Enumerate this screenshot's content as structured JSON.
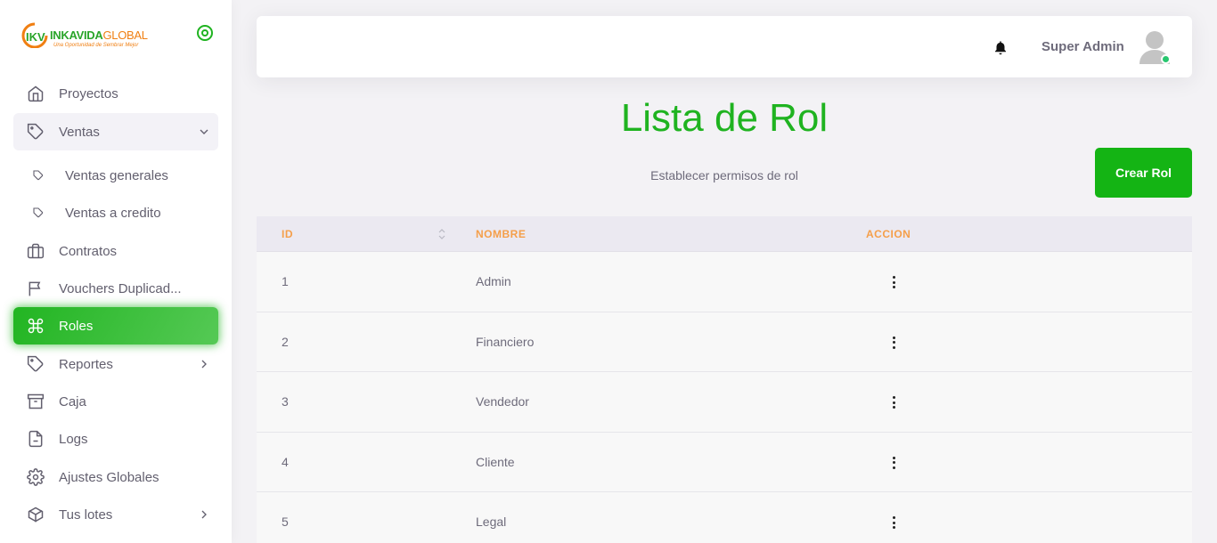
{
  "brand": {
    "name_part1": "IKV",
    "name_part2": "INKAVIDA",
    "name_part3": "GLOBAL",
    "tagline": "Una Oportunidad de Sembrar Mejor"
  },
  "colors": {
    "accent": "#1fb320",
    "header_text": "#f59f4a"
  },
  "sidebar": {
    "items": [
      {
        "label": "Proyectos",
        "icon": "home-icon"
      },
      {
        "label": "Ventas",
        "icon": "tag-icon",
        "expanded": true
      },
      {
        "label": "Ventas generales",
        "icon": "tag-icon"
      },
      {
        "label": "Ventas a credito",
        "icon": "tag-icon"
      },
      {
        "label": "Contratos",
        "icon": "briefcase-icon"
      },
      {
        "label": "Vouchers Duplicad...",
        "icon": "flag-icon"
      },
      {
        "label": "Roles",
        "icon": "command-icon",
        "active": true
      },
      {
        "label": "Reportes",
        "icon": "tag-icon"
      },
      {
        "label": "Caja",
        "icon": "archive-icon"
      },
      {
        "label": "Logs",
        "icon": "file-icon"
      },
      {
        "label": "Ajustes Globales",
        "icon": "settings-icon"
      },
      {
        "label": "Tus lotes",
        "icon": "box-icon"
      }
    ]
  },
  "header": {
    "user_name": "Super Admin"
  },
  "main": {
    "title": "Lista de Rol",
    "subtitle": "Establecer permisos de rol",
    "create_button": "Crear Rol"
  },
  "table": {
    "columns": [
      "ID",
      "NOMBRE",
      "ACCION"
    ],
    "rows": [
      {
        "id": "1",
        "name": "Admin"
      },
      {
        "id": "2",
        "name": "Financiero"
      },
      {
        "id": "3",
        "name": "Vendedor"
      },
      {
        "id": "4",
        "name": "Cliente"
      },
      {
        "id": "5",
        "name": "Legal"
      }
    ]
  }
}
